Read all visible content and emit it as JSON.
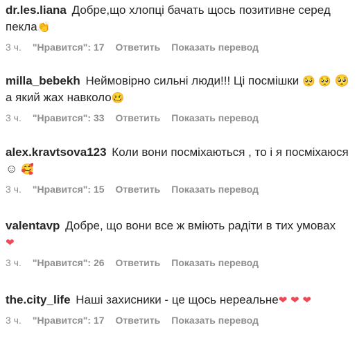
{
  "comments": [
    {
      "username": "dr.les.liana",
      "text": "Добре,що хлопці бачать щось позитивне серед пекла",
      "emoji": "👏",
      "time": "3 ч.",
      "likes": "\"Нравится\": 17",
      "reply": "Ответить",
      "translate": "Показать перевод"
    },
    {
      "username": "milla_bebekh",
      "text": "Неймовірно сильні люди!!! Ці посмішки",
      "emoji": "🥺 🥺",
      "text2": " 🥺  а який жах навколо",
      "emoji2": "🥴",
      "time": "3 ч.",
      "likes": "\"Нравится\": 33",
      "reply": "Ответить",
      "translate": "Показать перевод"
    },
    {
      "username": "alex.kravtsova123",
      "text": "Коли вони посміхаються , то і я посміхаюся ☺",
      "emoji": "🥰",
      "time": "3 ч.",
      "likes": "\"Нравится\": 15",
      "reply": "Ответить",
      "translate": "Показать перевод"
    },
    {
      "username": "valentavp",
      "text": "Добре, що вони все ж вміють радіти в тих умовах",
      "emoji": "❤",
      "time": "3 ч.",
      "likes": "\"Нравится\": 26",
      "reply": "Ответить",
      "translate": "Показать перевод"
    },
    {
      "username": "the.city_life",
      "text": "Наші захисники - це щось нереальне",
      "emoji": "❤ ❤ ❤",
      "time": "3 ч.",
      "likes": "\"Нравится\": 17",
      "reply": "Ответить",
      "translate": "Показать перевод"
    }
  ],
  "colors": {
    "text": "#262626",
    "meta": "#8e8e8e",
    "heart": "#ed4956"
  }
}
